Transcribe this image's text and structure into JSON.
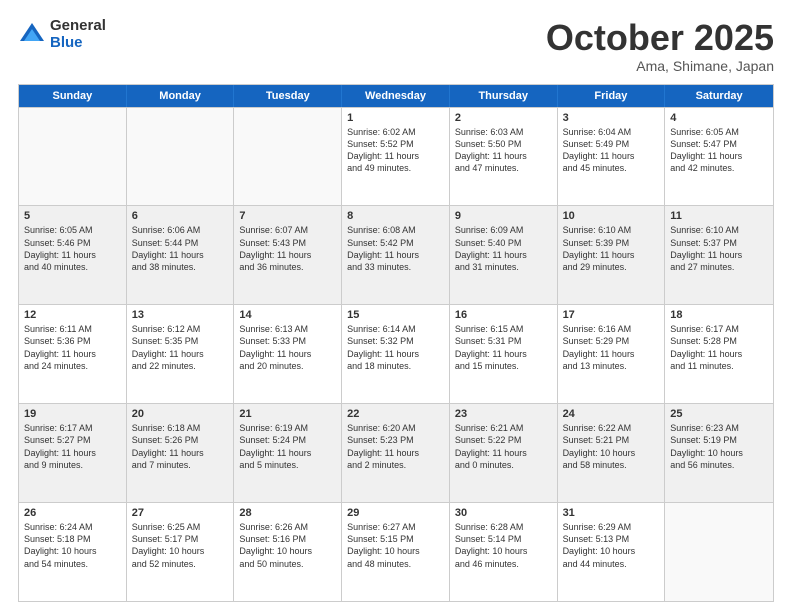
{
  "logo": {
    "general": "General",
    "blue": "Blue"
  },
  "title": "October 2025",
  "location": "Ama, Shimane, Japan",
  "days": [
    "Sunday",
    "Monday",
    "Tuesday",
    "Wednesday",
    "Thursday",
    "Friday",
    "Saturday"
  ],
  "rows": [
    [
      {
        "day": "",
        "text": ""
      },
      {
        "day": "",
        "text": ""
      },
      {
        "day": "",
        "text": ""
      },
      {
        "day": "1",
        "text": "Sunrise: 6:02 AM\nSunset: 5:52 PM\nDaylight: 11 hours\nand 49 minutes."
      },
      {
        "day": "2",
        "text": "Sunrise: 6:03 AM\nSunset: 5:50 PM\nDaylight: 11 hours\nand 47 minutes."
      },
      {
        "day": "3",
        "text": "Sunrise: 6:04 AM\nSunset: 5:49 PM\nDaylight: 11 hours\nand 45 minutes."
      },
      {
        "day": "4",
        "text": "Sunrise: 6:05 AM\nSunset: 5:47 PM\nDaylight: 11 hours\nand 42 minutes."
      }
    ],
    [
      {
        "day": "5",
        "text": "Sunrise: 6:05 AM\nSunset: 5:46 PM\nDaylight: 11 hours\nand 40 minutes."
      },
      {
        "day": "6",
        "text": "Sunrise: 6:06 AM\nSunset: 5:44 PM\nDaylight: 11 hours\nand 38 minutes."
      },
      {
        "day": "7",
        "text": "Sunrise: 6:07 AM\nSunset: 5:43 PM\nDaylight: 11 hours\nand 36 minutes."
      },
      {
        "day": "8",
        "text": "Sunrise: 6:08 AM\nSunset: 5:42 PM\nDaylight: 11 hours\nand 33 minutes."
      },
      {
        "day": "9",
        "text": "Sunrise: 6:09 AM\nSunset: 5:40 PM\nDaylight: 11 hours\nand 31 minutes."
      },
      {
        "day": "10",
        "text": "Sunrise: 6:10 AM\nSunset: 5:39 PM\nDaylight: 11 hours\nand 29 minutes."
      },
      {
        "day": "11",
        "text": "Sunrise: 6:10 AM\nSunset: 5:37 PM\nDaylight: 11 hours\nand 27 minutes."
      }
    ],
    [
      {
        "day": "12",
        "text": "Sunrise: 6:11 AM\nSunset: 5:36 PM\nDaylight: 11 hours\nand 24 minutes."
      },
      {
        "day": "13",
        "text": "Sunrise: 6:12 AM\nSunset: 5:35 PM\nDaylight: 11 hours\nand 22 minutes."
      },
      {
        "day": "14",
        "text": "Sunrise: 6:13 AM\nSunset: 5:33 PM\nDaylight: 11 hours\nand 20 minutes."
      },
      {
        "day": "15",
        "text": "Sunrise: 6:14 AM\nSunset: 5:32 PM\nDaylight: 11 hours\nand 18 minutes."
      },
      {
        "day": "16",
        "text": "Sunrise: 6:15 AM\nSunset: 5:31 PM\nDaylight: 11 hours\nand 15 minutes."
      },
      {
        "day": "17",
        "text": "Sunrise: 6:16 AM\nSunset: 5:29 PM\nDaylight: 11 hours\nand 13 minutes."
      },
      {
        "day": "18",
        "text": "Sunrise: 6:17 AM\nSunset: 5:28 PM\nDaylight: 11 hours\nand 11 minutes."
      }
    ],
    [
      {
        "day": "19",
        "text": "Sunrise: 6:17 AM\nSunset: 5:27 PM\nDaylight: 11 hours\nand 9 minutes."
      },
      {
        "day": "20",
        "text": "Sunrise: 6:18 AM\nSunset: 5:26 PM\nDaylight: 11 hours\nand 7 minutes."
      },
      {
        "day": "21",
        "text": "Sunrise: 6:19 AM\nSunset: 5:24 PM\nDaylight: 11 hours\nand 5 minutes."
      },
      {
        "day": "22",
        "text": "Sunrise: 6:20 AM\nSunset: 5:23 PM\nDaylight: 11 hours\nand 2 minutes."
      },
      {
        "day": "23",
        "text": "Sunrise: 6:21 AM\nSunset: 5:22 PM\nDaylight: 11 hours\nand 0 minutes."
      },
      {
        "day": "24",
        "text": "Sunrise: 6:22 AM\nSunset: 5:21 PM\nDaylight: 10 hours\nand 58 minutes."
      },
      {
        "day": "25",
        "text": "Sunrise: 6:23 AM\nSunset: 5:19 PM\nDaylight: 10 hours\nand 56 minutes."
      }
    ],
    [
      {
        "day": "26",
        "text": "Sunrise: 6:24 AM\nSunset: 5:18 PM\nDaylight: 10 hours\nand 54 minutes."
      },
      {
        "day": "27",
        "text": "Sunrise: 6:25 AM\nSunset: 5:17 PM\nDaylight: 10 hours\nand 52 minutes."
      },
      {
        "day": "28",
        "text": "Sunrise: 6:26 AM\nSunset: 5:16 PM\nDaylight: 10 hours\nand 50 minutes."
      },
      {
        "day": "29",
        "text": "Sunrise: 6:27 AM\nSunset: 5:15 PM\nDaylight: 10 hours\nand 48 minutes."
      },
      {
        "day": "30",
        "text": "Sunrise: 6:28 AM\nSunset: 5:14 PM\nDaylight: 10 hours\nand 46 minutes."
      },
      {
        "day": "31",
        "text": "Sunrise: 6:29 AM\nSunset: 5:13 PM\nDaylight: 10 hours\nand 44 minutes."
      },
      {
        "day": "",
        "text": ""
      }
    ]
  ]
}
